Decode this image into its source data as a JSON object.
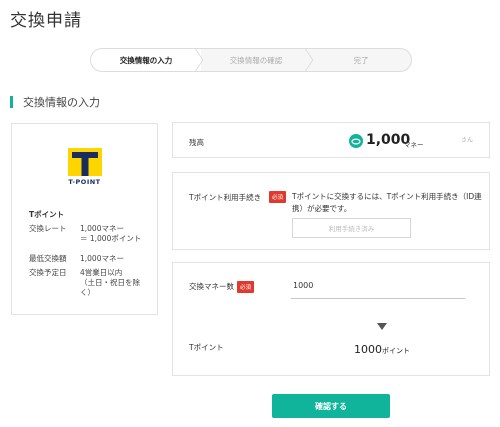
{
  "page": {
    "title": "交換申請"
  },
  "steps": [
    {
      "label": "交換情報の入力",
      "active": true
    },
    {
      "label": "交換情報の確認",
      "active": false
    },
    {
      "label": "完了",
      "active": false
    }
  ],
  "section": {
    "title": "交換情報の入力"
  },
  "partner": {
    "logo_text": "T-POINT",
    "name": "Tポイント",
    "rows": [
      {
        "label": "交換レート",
        "value": "1,000マネー\n＝ 1,000ポイント"
      },
      {
        "label": "最低交換額",
        "value": "1,000マネー"
      },
      {
        "label": "交換予定日",
        "value": "4営業日以内\n（土日・祝日を除く）"
      }
    ]
  },
  "balance": {
    "label": "残高",
    "value": "1,000",
    "unit": "マネー",
    "suffix": "さん"
  },
  "procedure": {
    "label": "Tポイント利用手続き",
    "badge": "必須",
    "text": "Tポイントに交換するには、Tポイント利用手続き（ID連携）が必要です。",
    "button": "利用手続き済み"
  },
  "exchange": {
    "label": "交換マネー数",
    "badge": "必須",
    "input_value": "1000",
    "result_label": "Tポイント",
    "result_value": "1000",
    "result_unit": "ポイント"
  },
  "actions": {
    "confirm": "確認する"
  },
  "colors": {
    "accent": "#10b49a",
    "required": "#e0392f",
    "tpoint_yellow": "#ffd500",
    "tpoint_navy": "#1a2d5e"
  }
}
